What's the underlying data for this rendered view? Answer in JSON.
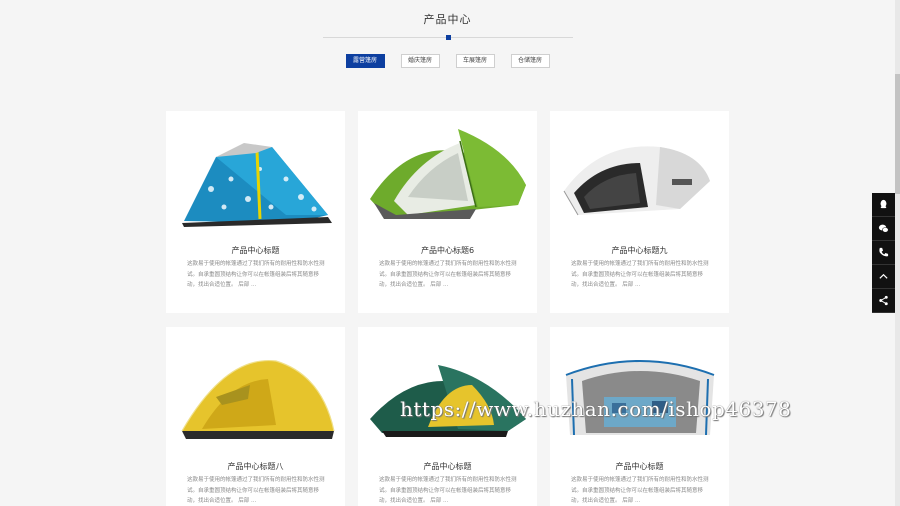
{
  "section": {
    "title": "产品中心"
  },
  "tabs": [
    {
      "label": "露营篷房",
      "active": true
    },
    {
      "label": "婚庆篷房"
    },
    {
      "label": "车展篷房"
    },
    {
      "label": "仓储篷房"
    }
  ],
  "products": [
    {
      "name": "产品中心标题",
      "desc": "这款易于使用的帐篷通过了我们所有的耐用性和防水性测试。自承重圆顶结构让你可以在帐篷组装后将其随意移动，找出合适位置。 后部 ...",
      "image": "blue-pattern-dome-tent"
    },
    {
      "name": "产品中心标题6",
      "desc": "这款易于使用的帐篷通过了我们所有的耐用性和防水性测试。自承重圆顶结构让你可以在帐篷组装后将其随意移动，找出合适位置。 后部 ...",
      "image": "green-dome-tent"
    },
    {
      "name": "产品中心标题九",
      "desc": "这款易于使用的帐篷通过了我们所有的耐用性和防水性测试。自承重圆顶结构让你可以在帐篷组装后将其随意移动，找出合适位置。 后部 ...",
      "image": "white-popup-tent"
    },
    {
      "name": "产品中心标题八",
      "desc": "这款易于使用的帐篷通过了我们所有的耐用性和防水性测试。自承重圆顶结构让你可以在帐篷组装后将其随意移动，找出合适位置。 后部 ...",
      "image": "yellow-dome-tent"
    },
    {
      "name": "产品中心标题",
      "desc": "这款易于使用的帐篷通过了我们所有的耐用性和防水性测试。自承重圆顶结构让你可以在帐篷组装后将其随意移动，找出合适位置。 后部 ...",
      "image": "dark-green-dome-tent"
    },
    {
      "name": "产品中心标题",
      "desc": "这款易于使用的帐篷通过了我们所有的耐用性和防水性测试。自承重圆顶结构让你可以在帐篷组装后将其随意移动，找出合适位置。 后部 ...",
      "image": "white-shelter-tent"
    }
  ],
  "float_bar": [
    "qq-icon",
    "wechat-icon",
    "phone-icon",
    "back-to-top-icon",
    "share-icon"
  ],
  "watermark": "https://www.huzhan.com/ishop46378",
  "colors": {
    "accent": "#0d3fa0",
    "background": "#f5f5f5"
  }
}
